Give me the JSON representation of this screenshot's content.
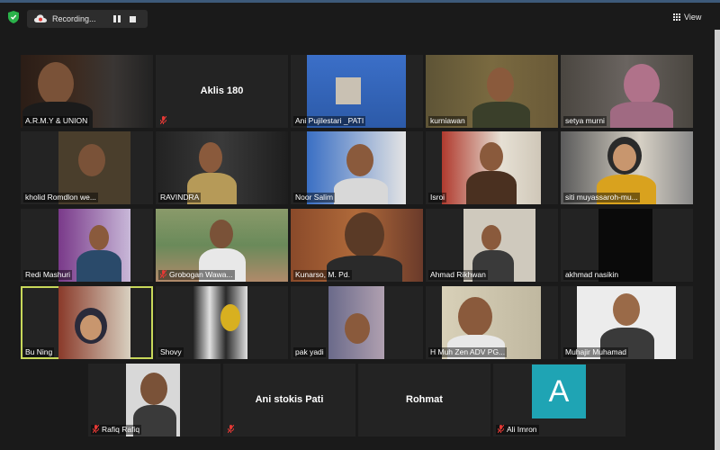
{
  "recording": {
    "label": "Recording..."
  },
  "view": {
    "label": "View"
  },
  "colors": {
    "active_speaker_border": "#c8d85a",
    "avatar_bg": "#1fa4b4",
    "mute_icon": "#e53935",
    "background": "#1a1a1a"
  },
  "participants": [
    {
      "name": "A.R.M.Y & UNION",
      "video": true,
      "muted": false
    },
    {
      "name": "Aklis 180",
      "video": false,
      "muted": true
    },
    {
      "name": "Ani Pujilestari _PATI",
      "video": true,
      "muted": false
    },
    {
      "name": "kurniawan",
      "video": true,
      "muted": false
    },
    {
      "name": "setya murni",
      "video": true,
      "muted": false
    },
    {
      "name": "kholid Romdlon we...",
      "video": true,
      "muted": false
    },
    {
      "name": "RAVINDRA",
      "video": true,
      "muted": false
    },
    {
      "name": "Noor Salim",
      "video": true,
      "muted": false
    },
    {
      "name": "Isroi",
      "video": true,
      "muted": false
    },
    {
      "name": "siti muyassaroh-mu...",
      "video": true,
      "muted": false
    },
    {
      "name": "Redi Mashuri",
      "video": true,
      "muted": false
    },
    {
      "name": "Grobogan Wawa...",
      "video": true,
      "muted": true
    },
    {
      "name": "Kunarso, M. Pd.",
      "video": true,
      "muted": false
    },
    {
      "name": "Ahmad Rikhwan",
      "video": true,
      "muted": false
    },
    {
      "name": "akhmad nasikin",
      "video": true,
      "muted": false
    },
    {
      "name": "Bu Ning",
      "video": true,
      "muted": false,
      "active": true
    },
    {
      "name": "Shovy",
      "video": true,
      "muted": false
    },
    {
      "name": "pak yadi",
      "video": true,
      "muted": false
    },
    {
      "name": "H Muh Zen ADV PG...",
      "video": true,
      "muted": false
    },
    {
      "name": "Muhajir Muhamad",
      "video": true,
      "muted": false
    },
    {
      "name": "Rafiq Rafiq",
      "video": true,
      "muted": true
    },
    {
      "name": "Ani stokis Pati",
      "video": false,
      "muted": true
    },
    {
      "name": "Rohmat",
      "video": false,
      "muted": false
    },
    {
      "name": "Ali Imron",
      "video": false,
      "muted": true,
      "avatar_letter": "A"
    }
  ]
}
